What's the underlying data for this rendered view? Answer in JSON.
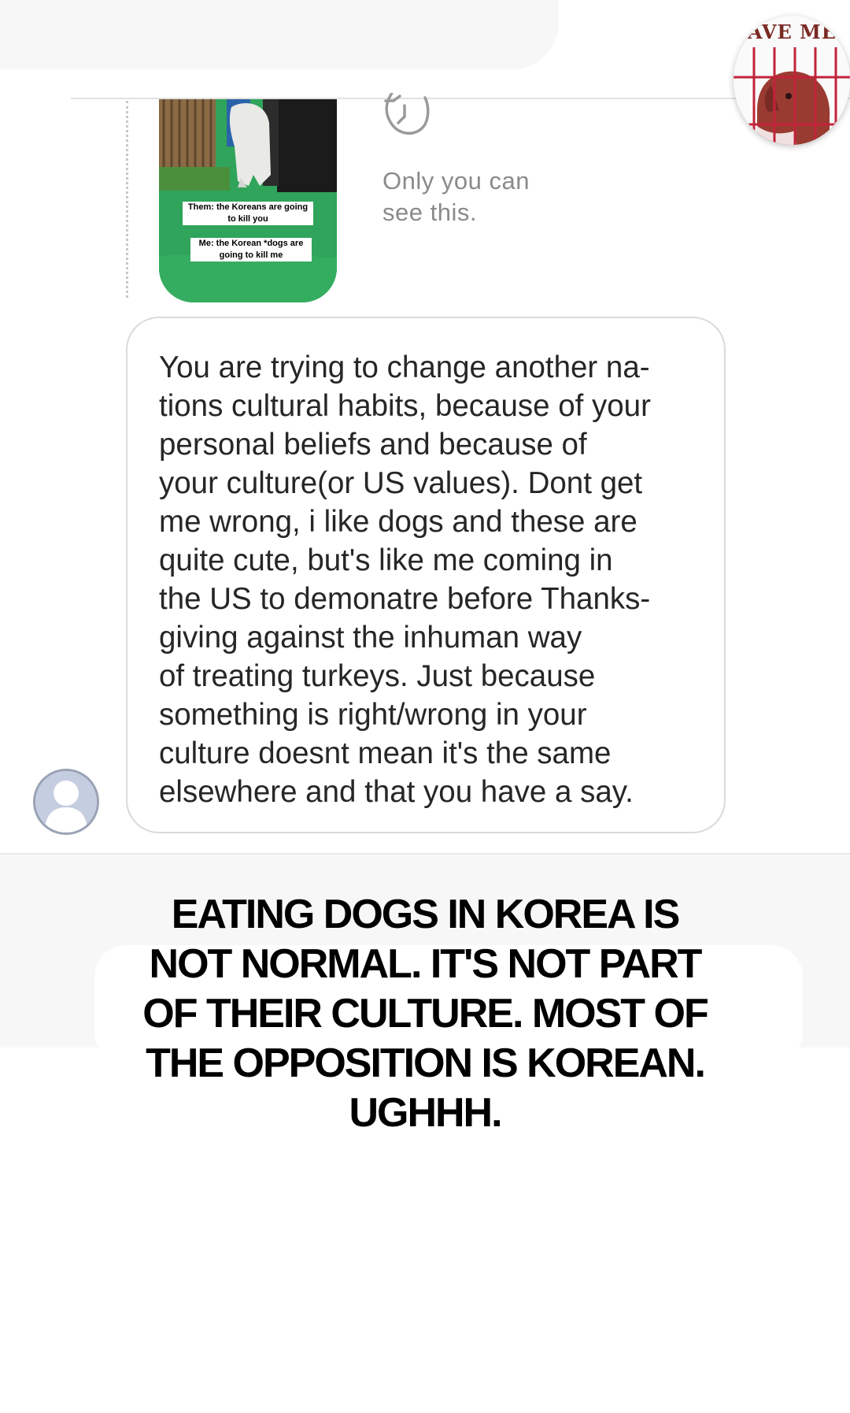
{
  "badge": {
    "text": "AVE ME"
  },
  "story": {
    "caption_top": "Them: the Koreans are going to kill you",
    "caption_bottom": "Me: the Korean *dogs are going to kill me"
  },
  "status": {
    "only_you_text": "Only you can\nsee this."
  },
  "message": {
    "text": "You are trying to change another na-\ntions cultural habits, because of your\npersonal beliefs and because of\nyour culture(or US values). Dont get\nme wrong, i like dogs and these are\nquite cute, but's like me coming in\nthe US to demonatre before Thanks-\ngiving against the inhuman way\nof treating turkeys. Just because\nsomething is right/wrong in your\nculture doesnt mean it's the same\nelsewhere and that you have a say."
  },
  "overlay_caption": {
    "text": "EATING DOGS IN KOREA IS\nNOT NORMAL. IT'S NOT PART\nOF THEIR CULTURE. MOST OF\nTHE OPPOSITION IS KOREAN.\nUGHHH."
  },
  "icons": {
    "reply": "reply-arrow-icon",
    "avatar": "default-user-avatar-icon"
  },
  "colors": {
    "bubble_border": "#dadada",
    "muted_text": "#8a8a8a",
    "story_green": "#2fa45a"
  }
}
